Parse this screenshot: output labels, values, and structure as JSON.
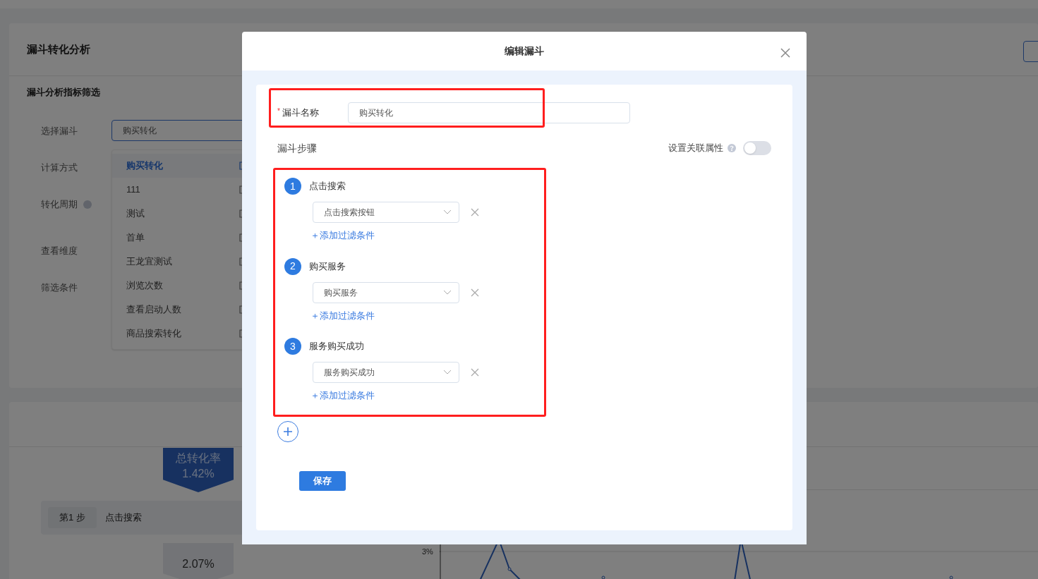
{
  "page": {
    "title": "漏斗转化分析",
    "section_title": "漏斗分析指标筛选",
    "form_labels": [
      {
        "label": "选择漏斗",
        "help": false
      },
      {
        "label": "计算方式",
        "help": false
      },
      {
        "label": "转化周期",
        "help": true
      },
      {
        "label": "查看维度",
        "help": false
      },
      {
        "label": "筛选条件",
        "help": false
      }
    ],
    "funnel_select": {
      "value": "购买转化"
    },
    "funnel_dropdown": [
      {
        "label": "购买转化",
        "selected": true
      },
      {
        "label": "111",
        "selected": false
      },
      {
        "label": "测试",
        "selected": false
      },
      {
        "label": "首单",
        "selected": false
      },
      {
        "label": "王龙宜测试",
        "selected": false
      },
      {
        "label": "浏览次数",
        "selected": false
      },
      {
        "label": "查看启动人数",
        "selected": false
      },
      {
        "label": "商品搜索转化",
        "selected": false
      }
    ],
    "funnel_chart": {
      "total_label": "总转化率",
      "total_rate": "1.42%",
      "steps": [
        {
          "tag": "第1 步",
          "name": "点击搜索"
        }
      ],
      "step_rate": "2.07%"
    },
    "trend_chart": {
      "y_tick": "3%"
    }
  },
  "dialog": {
    "title": "编辑漏斗",
    "name_field": {
      "label": "漏斗名称",
      "required": true,
      "required_mark": "*",
      "value": "购买转化"
    },
    "steps_heading": "漏斗步骤",
    "link_attribute": {
      "label": "设置关联属性",
      "on": false
    },
    "steps": [
      {
        "number": "1",
        "name": "点击搜索",
        "event": "点击搜索按钮",
        "add_filter": "＋添加过滤条件"
      },
      {
        "number": "2",
        "name": "购买服务",
        "event": "购买服务",
        "add_filter": "＋添加过滤条件"
      },
      {
        "number": "3",
        "name": "服务购买成功",
        "event": "服务购买成功",
        "add_filter": "＋添加过滤条件"
      }
    ],
    "save_button": "保存"
  }
}
